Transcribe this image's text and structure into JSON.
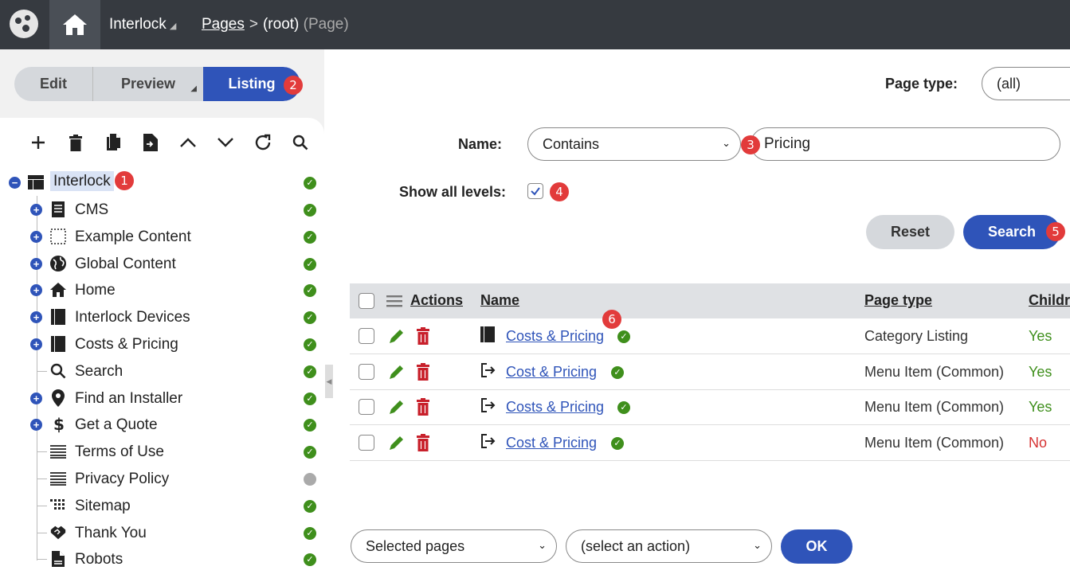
{
  "topbar": {
    "site_name": "Interlock",
    "breadcrumb_pages": "Pages",
    "breadcrumb_sep": ">",
    "breadcrumb_current": "(root)",
    "breadcrumb_type": "(Page)",
    "home_icon": "home-icon",
    "logo_icon": "app-logo-icon"
  },
  "view_tabs": {
    "edit": "Edit",
    "preview": "Preview",
    "listing": "Listing"
  },
  "badges": [
    "1",
    "2",
    "3",
    "4",
    "5",
    "6"
  ],
  "tree_toolbar": [
    "add-icon",
    "trash-icon",
    "copy-icon",
    "move-icon",
    "chevron-up-icon",
    "chevron-down-icon",
    "refresh-icon",
    "search-icon"
  ],
  "tree": {
    "root": {
      "label": "Interlock",
      "status": "published"
    },
    "items": [
      {
        "label": "CMS",
        "icon": "document-icon",
        "expandable": true,
        "status": "published"
      },
      {
        "label": "Example Content",
        "icon": "dashed-box-icon",
        "expandable": true,
        "status": "published"
      },
      {
        "label": "Global Content",
        "icon": "globe-icon",
        "expandable": true,
        "status": "published"
      },
      {
        "label": "Home",
        "icon": "home-icon",
        "expandable": true,
        "status": "published"
      },
      {
        "label": "Interlock Devices",
        "icon": "book-icon",
        "expandable": true,
        "status": "published"
      },
      {
        "label": "Costs & Pricing",
        "icon": "book-icon",
        "expandable": true,
        "status": "published"
      },
      {
        "label": "Search",
        "icon": "search-icon",
        "expandable": false,
        "status": "published"
      },
      {
        "label": "Find an Installer",
        "icon": "map-pin-icon",
        "expandable": true,
        "status": "published"
      },
      {
        "label": "Get a Quote",
        "icon": "dollar-icon",
        "expandable": true,
        "status": "published"
      },
      {
        "label": "Terms of Use",
        "icon": "lines-icon",
        "expandable": false,
        "status": "published"
      },
      {
        "label": "Privacy Policy",
        "icon": "lines-icon",
        "expandable": false,
        "status": "unpublished"
      },
      {
        "label": "Sitemap",
        "icon": "grid-icon",
        "expandable": false,
        "status": "published"
      },
      {
        "label": "Thank You",
        "icon": "handshake-icon",
        "expandable": false,
        "status": "published"
      },
      {
        "label": "Robots",
        "icon": "file-icon",
        "expandable": false,
        "status": "published"
      }
    ]
  },
  "filters": {
    "page_type_label": "Page type:",
    "page_type_value": "(all)",
    "name_label": "Name:",
    "name_operator": "Contains",
    "name_value": "Pricing",
    "show_all_label": "Show all levels:",
    "show_all_checked": true,
    "reset": "Reset",
    "search": "Search"
  },
  "table": {
    "headers": {
      "actions": "Actions",
      "name": "Name",
      "page_type": "Page type",
      "children": "Childr"
    },
    "rows": [
      {
        "icon": "book-icon",
        "name": "Costs & Pricing",
        "page_type": "Category Listing",
        "children": "Yes"
      },
      {
        "icon": "sign-out-icon",
        "name": "Cost & Pricing",
        "page_type": "Menu Item (Common)",
        "children": "Yes"
      },
      {
        "icon": "sign-out-icon",
        "name": "Costs & Pricing",
        "page_type": "Menu Item (Common)",
        "children": "Yes"
      },
      {
        "icon": "sign-out-icon",
        "name": "Cost & Pricing",
        "page_type": "Menu Item (Common)",
        "children": "No"
      }
    ]
  },
  "bulk": {
    "scope": "Selected pages",
    "action": "(select an action)",
    "ok": "OK"
  },
  "colors": {
    "topbar": "#363a40",
    "accent": "#2f54b9",
    "published": "#3f8f1c",
    "delete": "#c8202b",
    "edit": "#3f8f1c",
    "badge": "#e23b3b"
  }
}
